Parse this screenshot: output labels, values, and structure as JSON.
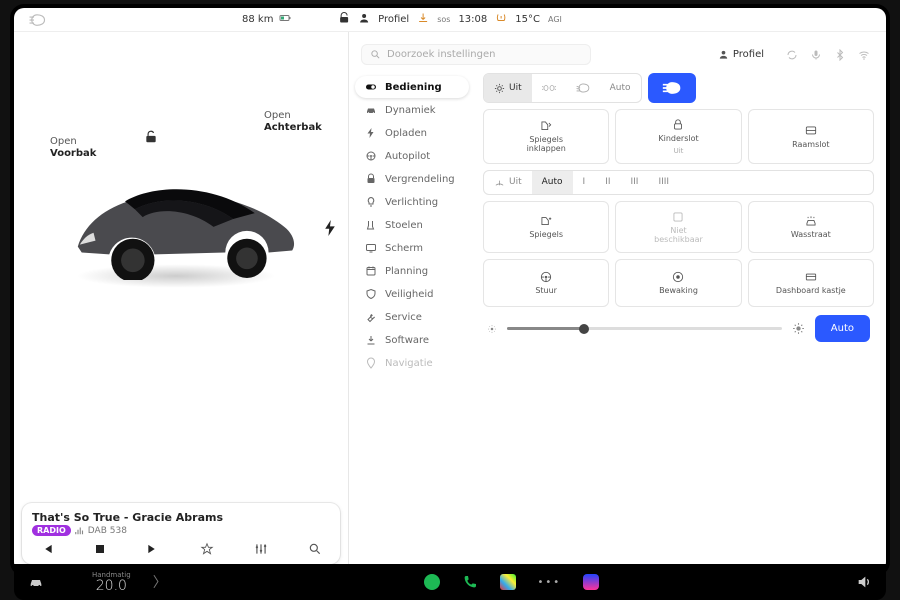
{
  "status": {
    "range": "88 km",
    "profile_label": "Profiel",
    "time": "13:08",
    "temp": "15°C",
    "sos": "sos",
    "agi": "AGI"
  },
  "car_view": {
    "frunk": {
      "line1": "Open",
      "line2": "Voorbak"
    },
    "trunk": {
      "line1": "Open",
      "line2": "Achterbak"
    }
  },
  "media": {
    "badge": "RADIO",
    "track": "That's So True - Gracie Abrams",
    "station": "DAB 538"
  },
  "settings": {
    "search_placeholder": "Doorzoek instellingen",
    "profile_label": "Profiel",
    "nav": [
      {
        "label": "Bediening",
        "icon": "toggle"
      },
      {
        "label": "Dynamiek",
        "icon": "car"
      },
      {
        "label": "Opladen",
        "icon": "bolt"
      },
      {
        "label": "Autopilot",
        "icon": "wheel"
      },
      {
        "label": "Vergrendeling",
        "icon": "lock"
      },
      {
        "label": "Verlichting",
        "icon": "bulb"
      },
      {
        "label": "Stoelen",
        "icon": "seat"
      },
      {
        "label": "Scherm",
        "icon": "screen"
      },
      {
        "label": "Planning",
        "icon": "calendar"
      },
      {
        "label": "Veiligheid",
        "icon": "shield"
      },
      {
        "label": "Service",
        "icon": "wrench"
      },
      {
        "label": "Software",
        "icon": "download"
      },
      {
        "label": "Navigatie",
        "icon": "pin"
      }
    ],
    "lights": {
      "off": "Uit",
      "park": "",
      "low": "",
      "auto": "Auto"
    },
    "row_cards1": {
      "mirrors": {
        "label": "Spiegels\ninklappen"
      },
      "childlock": {
        "label": "Kinderslot",
        "sub": "Uit"
      },
      "windowlock": {
        "label": "Raamslot"
      }
    },
    "wipers": {
      "off": "Uit",
      "auto": "Auto",
      "l1": "I",
      "l2": "II",
      "l3": "III",
      "l4": "IIII"
    },
    "row_cards2": {
      "mirrors_adj": {
        "label": "Spiegels"
      },
      "unavailable": {
        "label": "Niet\nbeschikbaar"
      },
      "carwash": {
        "label": "Wasstraat"
      }
    },
    "row_cards3": {
      "steering": {
        "label": "Stuur"
      },
      "sentry": {
        "label": "Bewaking"
      },
      "glovebox": {
        "label": "Dashboard kastje"
      }
    },
    "brightness_auto": "Auto"
  },
  "dock": {
    "temp_mode": "Handmatig",
    "temp_value": "20.0"
  }
}
